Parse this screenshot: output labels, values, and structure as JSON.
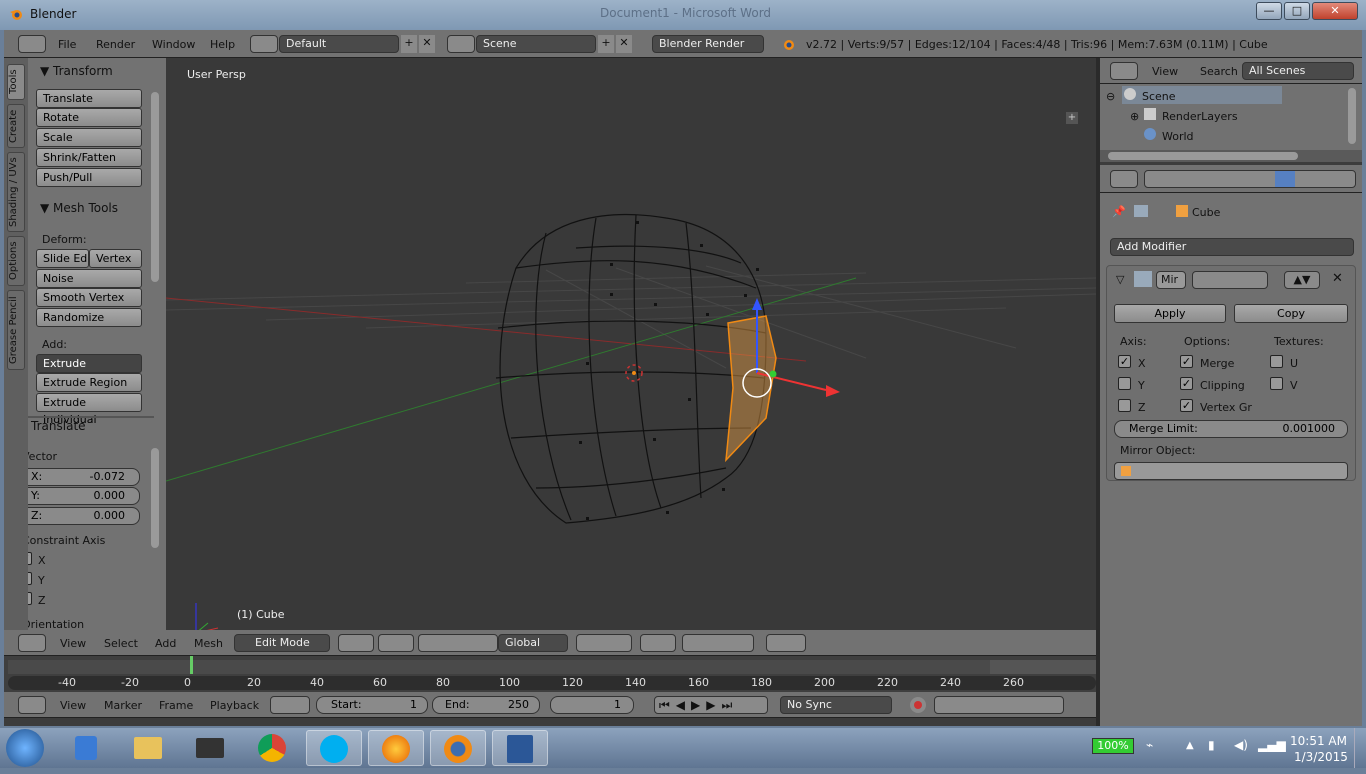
{
  "window": {
    "title": "Blender",
    "ghost_title": "Document1 - Microsoft Word",
    "min": "—",
    "max": "□",
    "close": "✕"
  },
  "info_header": {
    "menus": [
      "File",
      "Render",
      "Window",
      "Help"
    ],
    "layout": "Default",
    "scene": "Scene",
    "engine": "Blender Render",
    "stats": "v2.72 | Verts:9/57 | Edges:12/104 | Faces:4/48 | Tris:96 | Mem:7.63M (0.11M) | Cube"
  },
  "tabs": [
    "Tools",
    "Create",
    "Shading / UVs",
    "Options",
    "Grease Pencil"
  ],
  "transform_panel": {
    "title": "Transform",
    "buttons": [
      "Translate",
      "Rotate",
      "Scale",
      "Shrink/Fatten",
      "Push/Pull"
    ]
  },
  "mesh_tools_panel": {
    "title": "Mesh Tools",
    "deform_label": "Deform:",
    "slide_edge": "Slide Ed",
    "vertex": "Vertex",
    "buttons": [
      "Noise",
      "Smooth Vertex",
      "Randomize"
    ],
    "add_label": "Add:",
    "extrude": "Extrude",
    "extrude_region": "Extrude Region",
    "extrude_individual": "Extrude Individual"
  },
  "translate_op": {
    "title": "Translate",
    "vector_label": "Vector",
    "x_label": "X:",
    "x": "-0.072",
    "y_label": "Y:",
    "y": "0.000",
    "z_label": "Z:",
    "z": "0.000",
    "constraint_label": "Constraint Axis",
    "axes": [
      "X",
      "Y",
      "Z"
    ],
    "axes_checked": [
      true,
      false,
      false
    ],
    "orientation_label": "Orientation"
  },
  "viewport": {
    "view_name": "User Persp",
    "object_label": "(1) Cube"
  },
  "viewport_header": {
    "menus": [
      "View",
      "Select",
      "Add",
      "Mesh"
    ],
    "mode": "Edit Mode",
    "orientation": "Global"
  },
  "timeline": {
    "ticks": [
      "-40",
      "-20",
      "0",
      "20",
      "40",
      "60",
      "80",
      "100",
      "120",
      "140",
      "160",
      "180",
      "200",
      "220",
      "240",
      "260"
    ],
    "current_frame_value": 0
  },
  "timeline_header": {
    "menus": [
      "View",
      "Marker",
      "Frame",
      "Playback"
    ],
    "start_label": "Start:",
    "start": "1",
    "end_label": "End:",
    "end": "250",
    "current": "1",
    "sync": "No Sync"
  },
  "outliner": {
    "menus": [
      "View",
      "Search"
    ],
    "filter": "All Scenes",
    "items": [
      "Scene",
      "RenderLayers",
      "World"
    ]
  },
  "properties": {
    "breadcrumb": "Cube",
    "add_modifier": "Add Modifier",
    "modifier_name": "Mir",
    "apply": "Apply",
    "copy": "Copy",
    "axis_label": "Axis:",
    "options_label": "Options:",
    "textures_label": "Textures:",
    "axis": [
      {
        "label": "X",
        "checked": true
      },
      {
        "label": "Y",
        "checked": false
      },
      {
        "label": "Z",
        "checked": false
      }
    ],
    "options": [
      {
        "label": "Merge",
        "checked": true
      },
      {
        "label": "Clipping",
        "checked": true
      },
      {
        "label": "Vertex Gr",
        "checked": true
      }
    ],
    "textures": [
      {
        "label": "U",
        "checked": false
      },
      {
        "label": "V",
        "checked": false
      }
    ],
    "merge_limit_label": "Merge Limit:",
    "merge_limit": "0.001000",
    "mirror_object_label": "Mirror Object:"
  },
  "taskbar": {
    "apps": [
      "media-player-icon",
      "file-explorer-icon",
      "scanner-icon",
      "chrome-icon",
      "skype-icon",
      "firefox-icon",
      "blender-icon",
      "word-icon"
    ],
    "battery": "100%",
    "time": "10:51 AM",
    "date": "1/3/2015"
  },
  "colors": {
    "accent": "#f08a14",
    "selection": "#e8a046",
    "blender_blue": "#5680c2"
  }
}
